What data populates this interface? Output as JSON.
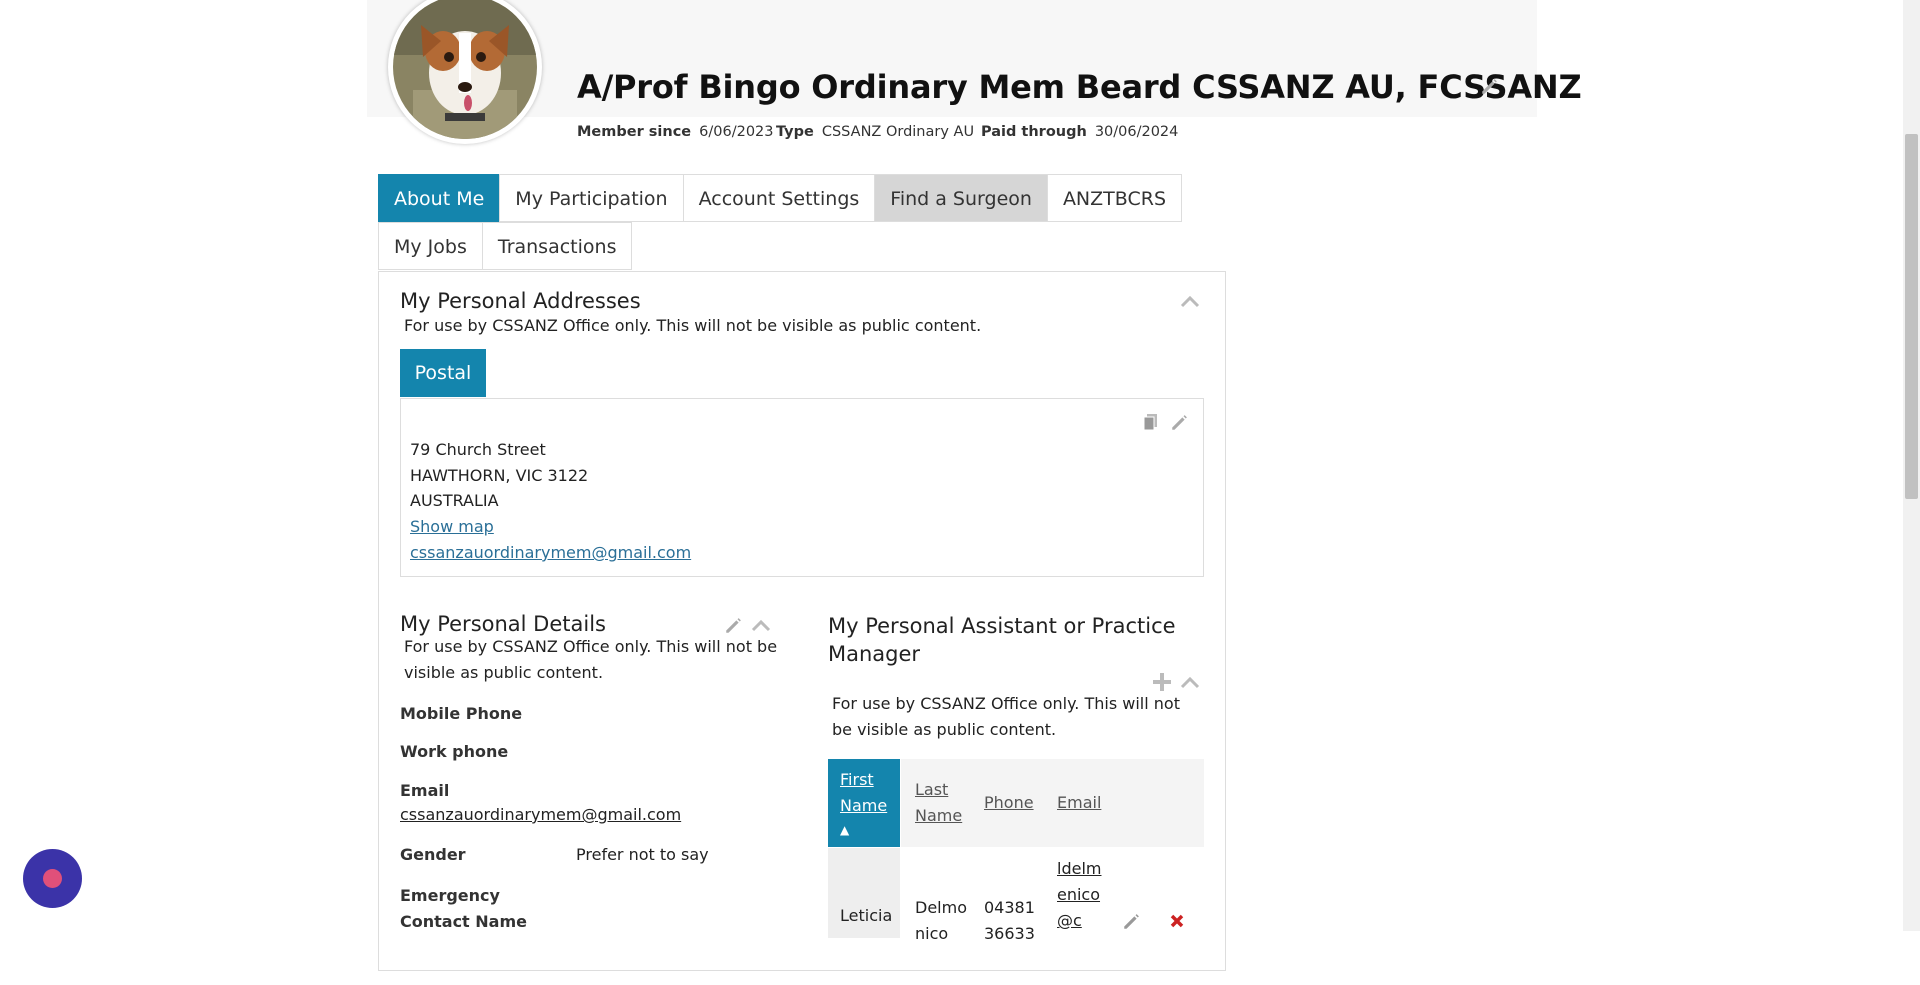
{
  "profile": {
    "name": "A/Prof Bingo Ordinary Mem Beard CSSANZ AU, FCSSANZ",
    "member_since_label": "Member since",
    "member_since": "6/06/2023",
    "type_label": "Type",
    "type": "CSSANZ Ordinary AU",
    "paid_through_label": "Paid through",
    "paid_through": "30/06/2024"
  },
  "tabs": [
    {
      "label": "About Me",
      "active": true
    },
    {
      "label": "My Participation"
    },
    {
      "label": "Account Settings"
    },
    {
      "label": "Find a Surgeon",
      "hover": true
    },
    {
      "label": "ANZTBCRS"
    },
    {
      "label": "My Jobs"
    },
    {
      "label": "Transactions"
    }
  ],
  "addresses": {
    "heading": "My Personal Addresses",
    "note": "For use by CSSANZ Office only. This will not be visible as public content.",
    "postal_tab": "Postal",
    "line1": "79 Church Street",
    "line2": "HAWTHORN, VIC 3122",
    "line3": "AUSTRALIA",
    "show_map": "Show map",
    "email": "cssanzauordinarymem@gmail.com"
  },
  "details": {
    "heading": "My Personal Details",
    "note": "For use by CSSANZ Office only. This will not be visible as public content.",
    "mobile_label": "Mobile Phone",
    "work_label": "Work phone",
    "email_label": "Email",
    "email": "cssanzauordinarymem@gmail.com",
    "gender_label": "Gender",
    "gender": "Prefer not to say",
    "emergency_label": "Emergency Contact Name"
  },
  "assistant": {
    "heading": "My Personal Assistant or Practice Manager",
    "note": "For use by CSSANZ Office only. This will not be visible as public content.",
    "columns": [
      "First Name",
      "Last Name",
      "Phone",
      "Email"
    ],
    "sort_indicator": "▲",
    "rows": [
      {
        "first": "Leticia",
        "last": "Delmonico",
        "phone": "0438136633",
        "email": "ldelmenico@c"
      }
    ]
  },
  "colors": {
    "accent": "#1485ad",
    "link": "#2a6f97",
    "delete": "#cc2222",
    "chat": "#3b33a8"
  }
}
